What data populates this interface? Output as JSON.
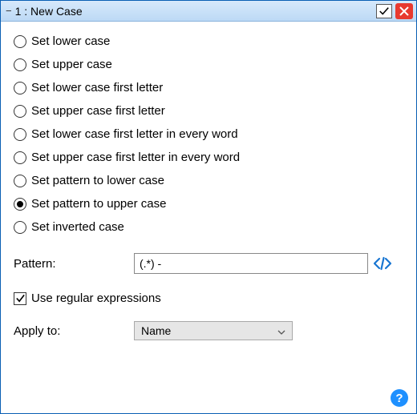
{
  "title": "1 : New Case",
  "options": [
    {
      "label": "Set lower case",
      "selected": false
    },
    {
      "label": "Set upper case",
      "selected": false
    },
    {
      "label": "Set lower case first letter",
      "selected": false
    },
    {
      "label": "Set upper case first letter",
      "selected": false
    },
    {
      "label": "Set lower case first letter in every word",
      "selected": false
    },
    {
      "label": "Set upper case first letter in every word",
      "selected": false
    },
    {
      "label": "Set pattern to lower case",
      "selected": false
    },
    {
      "label": "Set pattern to upper case",
      "selected": true
    },
    {
      "label": "Set inverted case",
      "selected": false
    }
  ],
  "pattern": {
    "label": "Pattern:",
    "value": "(.*) -"
  },
  "regex": {
    "label": "Use regular expressions",
    "checked": true
  },
  "applyTo": {
    "label": "Apply to:",
    "value": "Name"
  },
  "help_glyph": "?"
}
